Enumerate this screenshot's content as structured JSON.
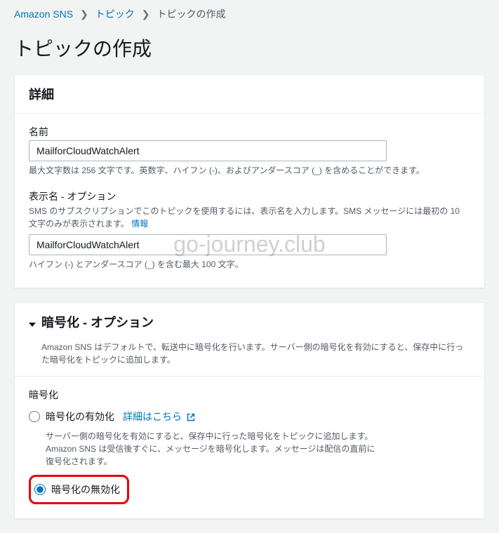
{
  "breadcrumb": {
    "root": "Amazon SNS",
    "mid": "トピック",
    "current": "トピックの作成"
  },
  "page_title": "トピックの作成",
  "details": {
    "header": "詳細",
    "name": {
      "label": "名前",
      "value": "MailforCloudWatchAlert",
      "helper": "最大文字数は 256 文字です。英数字、ハイフン (-)、およびアンダースコア (_) を含めることができます。"
    },
    "display_name": {
      "label": "表示名 - オプション",
      "sublabel_pre": "SMS のサブスクリプションでこのトピックを使用するには、表示名を入力します。SMS メッセージには最初の 10 文字のみが表示されます。 ",
      "info_link": "情報",
      "value": "MailforCloudWatchAlert",
      "helper": "ハイフン (-) とアンダースコア (_) を含む最大 100 文字。"
    }
  },
  "encryption": {
    "header": "暗号化 - オプション",
    "description": "Amazon SNS はデフォルトで、転送中に暗号化を行います。サーバー側の暗号化を有効にすると、保存中に行った暗号化をトピックに追加します。",
    "section_label": "暗号化",
    "enable": {
      "label": "暗号化の有効化",
      "link": "詳細はこちら",
      "sub": "サーバー側の暗号化を有効にすると、保存中に行った暗号化をトピックに追加します。Amazon SNS は受信後すぐに、メッセージを暗号化します。メッセージは配信の直前に復号化されます。"
    },
    "disable": {
      "label": "暗号化の無効化"
    }
  },
  "watermark": "go-journey.club"
}
